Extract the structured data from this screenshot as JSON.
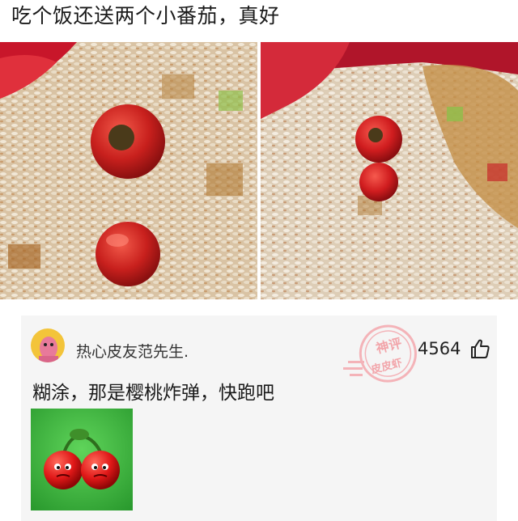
{
  "post": {
    "title": "吃个饭还送两个小番茄，真好"
  },
  "comment": {
    "username": "热心皮友范先生.",
    "text": "糊涂，那是樱桃炸弹，快跑吧",
    "like_count": "4564"
  },
  "watermark": {
    "line1": "神评",
    "line2": "皮皮虾"
  },
  "icons": {
    "like": "thumbs-up-icon"
  }
}
